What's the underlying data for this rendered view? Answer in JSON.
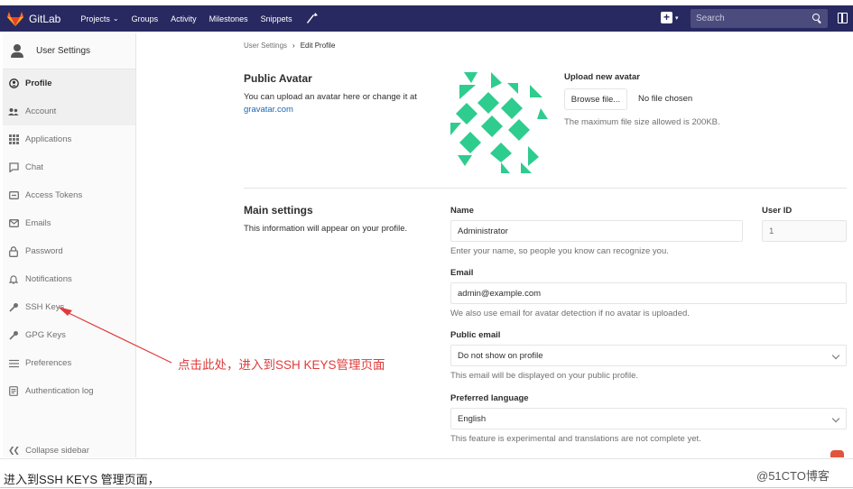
{
  "topbar": {
    "brand": "GitLab",
    "nav": [
      {
        "label": "Projects",
        "has_dropdown": true
      },
      {
        "label": "Groups",
        "has_dropdown": false
      },
      {
        "label": "Activity",
        "has_dropdown": false
      },
      {
        "label": "Milestones",
        "has_dropdown": false
      },
      {
        "label": "Snippets",
        "has_dropdown": false
      }
    ],
    "search_placeholder": "Search",
    "icons": [
      "gitlab-logo-icon",
      "wrench-icon",
      "plus-icon",
      "search-icon",
      "sidebar-panel-icon"
    ]
  },
  "sidebar": {
    "title": "User Settings",
    "items": [
      {
        "label": "Profile",
        "icon": "profile-icon",
        "active": true
      },
      {
        "label": "Account",
        "icon": "account-icon",
        "active": false
      },
      {
        "label": "Applications",
        "icon": "applications-icon",
        "active": false
      },
      {
        "label": "Chat",
        "icon": "chat-icon",
        "active": false
      },
      {
        "label": "Access Tokens",
        "icon": "access-tokens-icon",
        "active": false
      },
      {
        "label": "Emails",
        "icon": "email-icon",
        "active": false
      },
      {
        "label": "Password",
        "icon": "lock-icon",
        "active": false
      },
      {
        "label": "Notifications",
        "icon": "bell-icon",
        "active": false
      },
      {
        "label": "SSH Keys",
        "icon": "key-icon",
        "active": false
      },
      {
        "label": "GPG Keys",
        "icon": "key-icon",
        "active": false
      },
      {
        "label": "Preferences",
        "icon": "sliders-icon",
        "active": false
      },
      {
        "label": "Authentication log",
        "icon": "log-icon",
        "active": false
      }
    ],
    "collapse": "Collapse sidebar"
  },
  "breadcrumb": {
    "parent": "User Settings",
    "separator": "›",
    "current": "Edit Profile"
  },
  "avatar_section": {
    "title": "Public Avatar",
    "desc": "You can upload an avatar here or change it at",
    "link": "gravatar.com",
    "upload_label": "Upload new avatar",
    "browse_button": "Browse file...",
    "file_status": "No file chosen",
    "max_size_note": "The maximum file size allowed is 200KB."
  },
  "main_settings": {
    "title": "Main settings",
    "desc": "This information will appear on your profile.",
    "name_label": "Name",
    "name_value": "Administrator",
    "name_help": "Enter your name, so people you know can recognize you.",
    "user_id_label": "User ID",
    "user_id_value": "1",
    "email_label": "Email",
    "email_value": "admin@example.com",
    "email_help": "We also use email for avatar detection if no avatar is uploaded.",
    "public_email_label": "Public email",
    "public_email_value": "Do not show on profile",
    "public_email_help": "This email will be displayed on your public profile.",
    "language_label": "Preferred language",
    "language_value": "English",
    "language_help": "This feature is experimental and translations are not complete yet."
  },
  "annotation": {
    "text": "点击此处，进入到SSH KEYS管理页面",
    "color": "#e03b3b"
  },
  "caption": "进入到SSH KEYS 管理页面，",
  "watermark": "@51CTO博客",
  "colors": {
    "topbar": "#292961",
    "identicon": "#2ecc8e",
    "link": "#1b69b6",
    "annotation": "#e03b3b"
  }
}
